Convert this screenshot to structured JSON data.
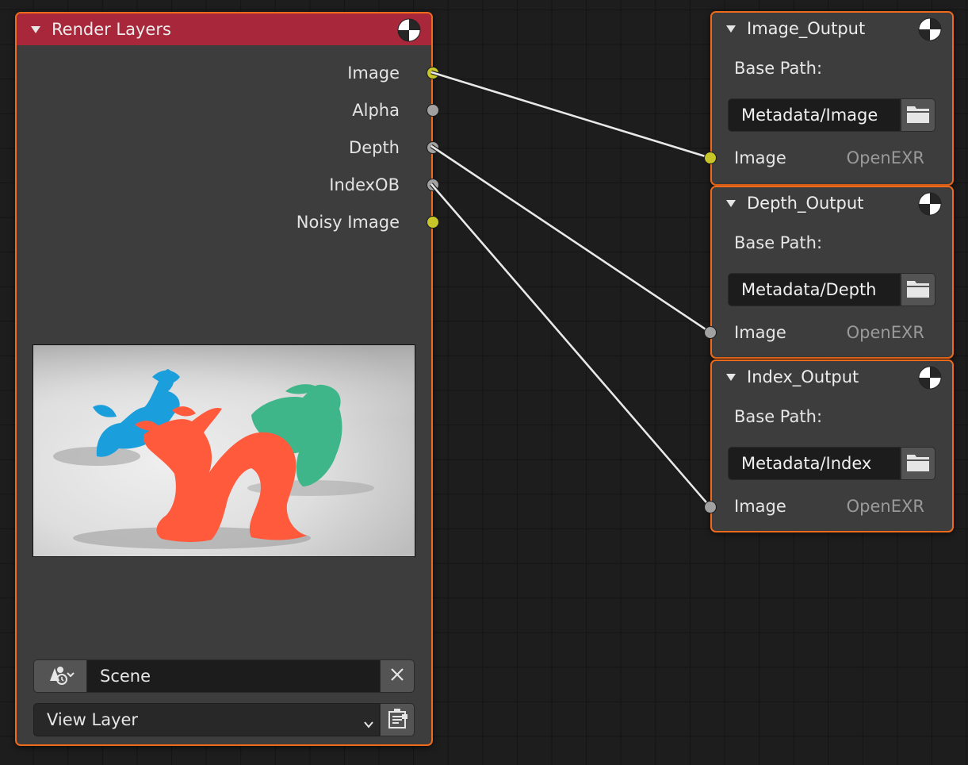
{
  "render_layers": {
    "title": "Render Layers",
    "outputs": [
      {
        "label": "Image",
        "socket": "yellow"
      },
      {
        "label": "Alpha",
        "socket": "grey"
      },
      {
        "label": "Depth",
        "socket": "grey"
      },
      {
        "label": "IndexOB",
        "socket": "grey"
      },
      {
        "label": "Noisy Image",
        "socket": "yellow"
      }
    ],
    "scene": "Scene",
    "view_layer": "View Layer"
  },
  "output_nodes": [
    {
      "title": "Image_Output",
      "base_path_label": "Base Path:",
      "path": "Metadata/Image",
      "input_label": "Image",
      "format": "OpenEXR",
      "socket": "yellow"
    },
    {
      "title": "Depth_Output",
      "base_path_label": "Base Path:",
      "path": "Metadata/Depth",
      "input_label": "Image",
      "format": "OpenEXR",
      "socket": "grey"
    },
    {
      "title": "Index_Output",
      "base_path_label": "Base Path:",
      "path": "Metadata/Index",
      "input_label": "Image",
      "format": "OpenEXR",
      "socket": "grey"
    }
  ],
  "links": [
    {
      "from": "Image",
      "to": "Image_Output"
    },
    {
      "from": "Depth",
      "to": "Depth_Output"
    },
    {
      "from": "IndexOB",
      "to": "Index_Output"
    }
  ],
  "colors": {
    "node_border_selected": "#f06a1b",
    "render_layers_header": "#a8273a",
    "socket_color": "#c7c729",
    "socket_value": "#a1a1a1",
    "link": "#e8e8e8"
  },
  "icons": {
    "collapse": "triangle-down-icon",
    "preview": "checker-sphere-icon",
    "scene": "scene-icon",
    "clear": "x-icon",
    "folder": "folder-icon",
    "view_layer": "render-layer-icon"
  }
}
